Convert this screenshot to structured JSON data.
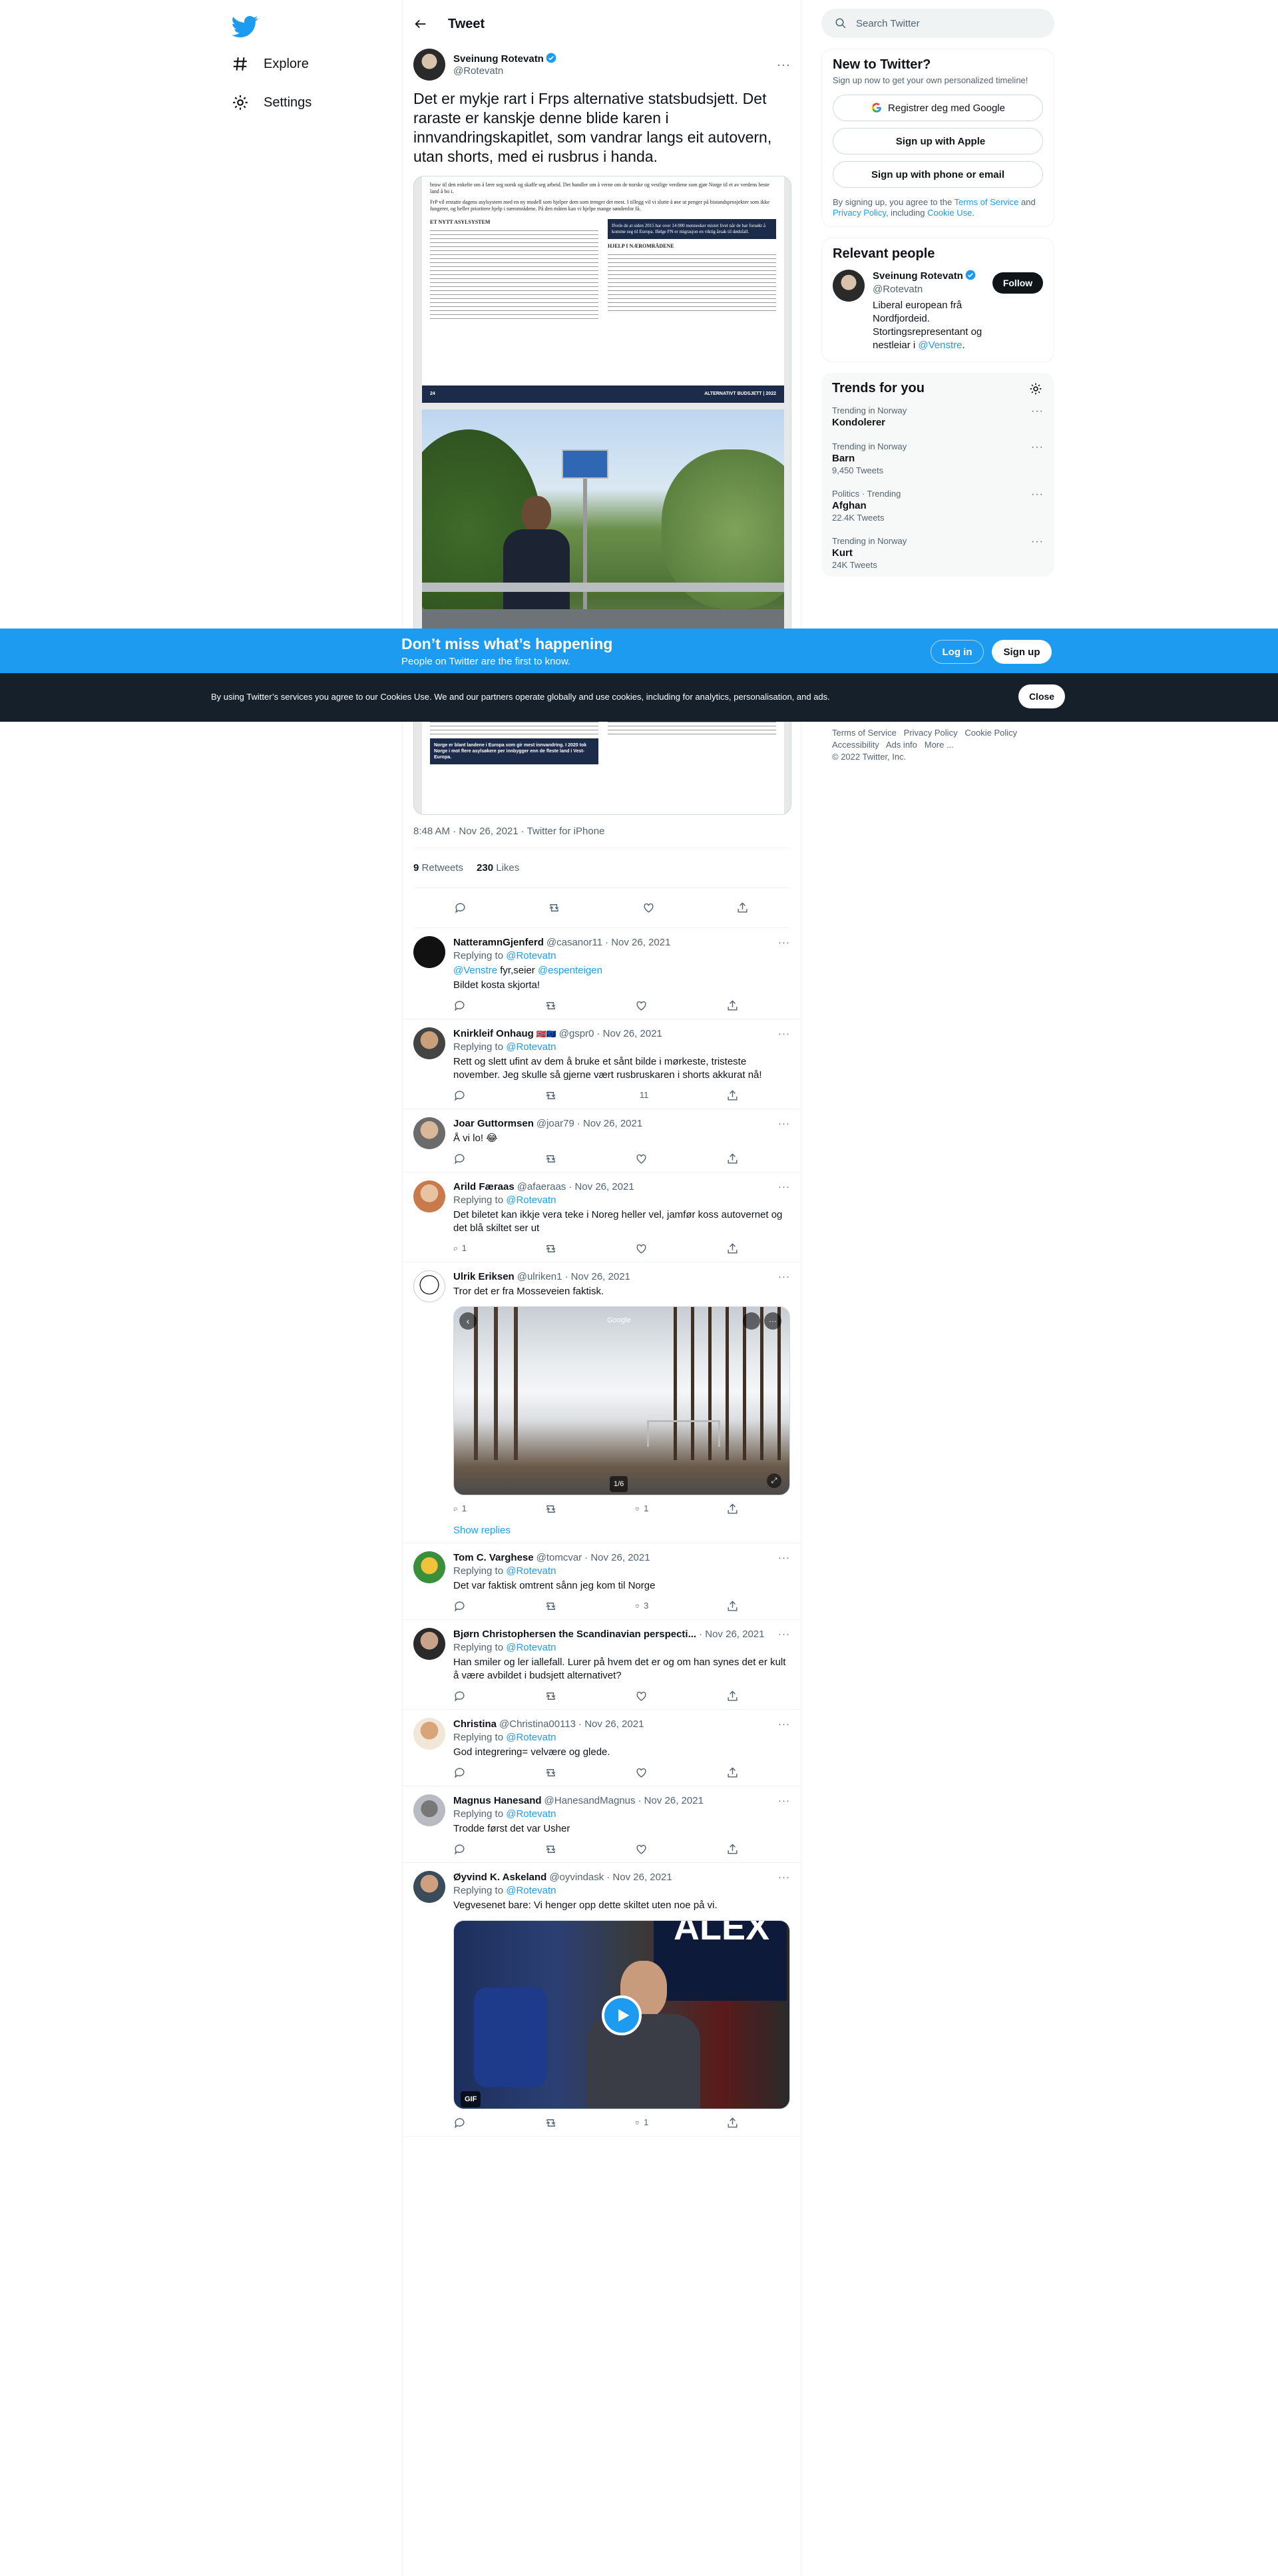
{
  "nav": {
    "explore": "Explore",
    "settings": "Settings"
  },
  "header": {
    "title": "Tweet"
  },
  "main_tweet": {
    "name": "Sveinung Rotevatn",
    "handle": "@Rotevatn",
    "text": "Det er mykje rart i Frps alternative statsbudsjett. Det raraste er kanskje denne blide karen i innvandringskapitlet, som vandrar langs eit autovern, utan shorts, med ei rusbrus i handa.",
    "doc_intro1": "bruw til den enkelte om å lære seg norsk og skaffe seg arbeid. Det handler om å verne om de norske og vestlige verdiene som gjør Norge til et av verdens beste land å bo i.",
    "doc_intro2": "FrP vil erstatte dagens asylsystem med en ny modell som hjelper dem som trenger det mest. I tillegg vil vi slutte å øse ut penger på bistandsprosjekter som ikke fungerer, og heller prioritere hjelp i nærområdene. På den måten kan vi hjelpe mange søndenfor få.",
    "doc_h1": "ET NYTT ASYLSYSTEM",
    "doc_h2": "HJELP I NÆROMRÅDENE",
    "doc_box": "Ifvele de at siden 2015 har over 14 000 mennesker mistet livet når de har forsøkt å komme seg til Europa. Ifølge FN er migrasjon en viktig årsak til dødsfall.",
    "doc_page_no": "24",
    "doc_page_title": "ALTERNATIVT BUDSJETT | 2022",
    "doc_box2": "Norge er blant landene i Europa som gir mest innvandring. I 2020 tok Norge i mot flere asylsøkere per innbygger enn de fleste land i Vest-Europa.",
    "time": "8:48 AM · Nov 26, 2021 · Twitter for iPhone",
    "retweets": "9",
    "retweets_label": "Retweets",
    "likes": "230",
    "likes_label": "Likes"
  },
  "replies": [
    {
      "name": "NatteramnGjenferd",
      "handle": "@casanor11",
      "date": "· Nov 26, 2021",
      "replying": "Replying to",
      "to": "@Rotevatn",
      "mention_line": "@Venstre",
      "mention_rest": " fyr,seier ",
      "mention2": "@espenteigen",
      "text": "Bildet kosta skjorta!",
      "rt": "",
      "like": ""
    },
    {
      "name": "Knirkleif Onhaug",
      "handle": "@gspr0",
      "date": "· Nov 26, 2021",
      "replying": "Replying to",
      "to": "@Rotevatn",
      "text": "Rett og slett ufint av dem å bruke et sånt bilde i mørkeste, tristeste november. Jeg skulle så gjerne vært rusbruskaren i shorts akkurat nå!",
      "reply_count": "",
      "rt": "",
      "like": "11"
    },
    {
      "name": "Joar Guttormsen",
      "handle": "@joar79",
      "date": "· Nov 26, 2021",
      "text": "Å vi lo! 😂",
      "rt": "",
      "like": ""
    },
    {
      "name": "Arild Færaas",
      "handle": "@afaeraas",
      "date": "· Nov 26, 2021",
      "replying": "Replying to",
      "to": "@Rotevatn",
      "text": "Det biletet kan ikkje vera teke i Noreg heller vel, jamfør koss autovernet og det blå skiltet ser ut",
      "reply_count": "1",
      "like": ""
    },
    {
      "name": "Ulrik Eriksen",
      "handle": "@ulriken1",
      "date": "· Nov 26, 2021",
      "text": "Tror det er fra Mosseveien faktisk.",
      "media_label": "Google",
      "media_counter": "1/6",
      "reply_count": "1",
      "like": "1",
      "show_replies": "Show replies"
    },
    {
      "name": "Tom C. Varghese",
      "handle": "@tomcvar",
      "date": "· Nov 26, 2021",
      "replying": "Replying to",
      "to": "@Rotevatn",
      "text": "Det var faktisk omtrent sånn jeg kom til Norge",
      "like": "3"
    },
    {
      "name": "Bjørn Christophersen the Scandinavian perspecti...",
      "handle": "",
      "date": "· Nov 26, 2021",
      "replying": "Replying to",
      "to": "@Rotevatn",
      "text": "Han smiler og ler iallefall. Lurer på hvem det er og om han synes det er kult å være avbildet i budsjett alternativet?"
    },
    {
      "name": "Christina",
      "handle": "@Christina00113",
      "date": "· Nov 26, 2021",
      "replying": "Replying to",
      "to": "@Rotevatn",
      "text": "God integrering= velvære og glede."
    },
    {
      "name": "Magnus Hanesand",
      "handle": "@HanesandMagnus",
      "date": "· Nov 26, 2021",
      "replying": "Replying to",
      "to": "@Rotevatn",
      "text": "Trodde først det var Usher"
    },
    {
      "name": "Øyvind K. Askeland",
      "handle": "@oyvindask",
      "date": "· Nov 26, 2021",
      "replying": "Replying to",
      "to": "@Rotevatn",
      "text": "Vegvesenet bare: Vi henger opp dette skiltet uten noe på vi.",
      "gif_label": "GIF",
      "like": "1"
    }
  ],
  "search": {
    "placeholder": "Search Twitter"
  },
  "new_to_twitter": {
    "title": "New to Twitter?",
    "sub": "Sign up now to get your own personalized timeline!",
    "google": "Registrer deg med Google",
    "apple": "Sign up with Apple",
    "phone": "Sign up with phone or email",
    "terms_pre": "By signing up, you agree to the ",
    "terms_link": "Terms of Service",
    "terms_and": " and ",
    "privacy_link": "Privacy Policy",
    "terms_incl": ", including ",
    "cookie_link": "Cookie Use",
    "terms_end": "."
  },
  "relevant": {
    "title": "Relevant people",
    "name": "Sveinung Rotevatn",
    "handle": "@Rotevatn",
    "follow": "Follow",
    "bio": "Liberal european frå Nordfjordeid. Stortingsrepresentant og nestleiar i ",
    "bio_link": "@Venstre",
    "bio_end": "."
  },
  "trends": {
    "title": "Trends for you",
    "items": [
      {
        "cat": "Trending in Norway",
        "name": "Kondolerer",
        "count": ""
      },
      {
        "cat": "Trending in Norway",
        "name": "Barn",
        "count": "9,450 Tweets"
      },
      {
        "cat": "Politics · Trending",
        "name": "Afghan",
        "count": "22.4K Tweets"
      },
      {
        "cat": "Trending in Norway",
        "name": "Kurt",
        "count": "24K Tweets"
      }
    ]
  },
  "footer": {
    "l1": "Terms of Service",
    "l2": "Privacy Policy",
    "l3": "Cookie Policy",
    "l4": "Accessibility",
    "l5": "Ads info",
    "l6": "More ...",
    "copy": "© 2022 Twitter, Inc."
  },
  "banner": {
    "title": "Don’t miss what’s happening",
    "sub": "People on Twitter are the first to know.",
    "login": "Log in",
    "signup": "Sign up"
  },
  "cookie": {
    "text": "By using Twitter’s services you agree to our Cookies Use. We and our partners operate globally and use cookies, including for analytics, personalisation, and ads.",
    "close": "Close"
  },
  "colors": {
    "accent": "#1d9bf0",
    "cookie_bg": "#15202b",
    "text": "#0f1419",
    "muted": "#536471"
  }
}
